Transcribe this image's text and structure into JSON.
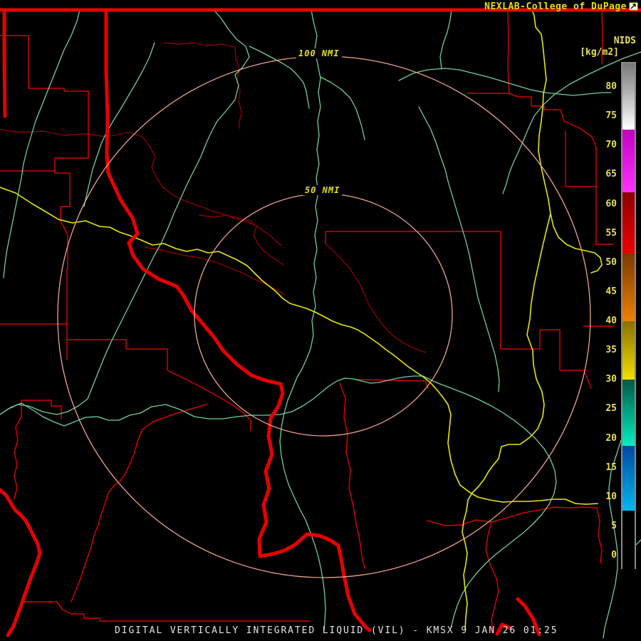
{
  "header": {
    "title": "NEXLAB-College of DuPage",
    "logo_icon": "nw-arrow-box-icon"
  },
  "colorbar": {
    "title": "NIDS",
    "units": "[kg/m2]",
    "ticks": [
      80,
      75,
      70,
      65,
      60,
      55,
      50,
      45,
      40,
      35,
      30,
      25,
      20,
      15,
      10,
      5,
      0
    ],
    "segments": [
      {
        "hi": 84.3,
        "lo": 73.0,
        "top_color": "#787878",
        "bottom_color": "#ffffff"
      },
      {
        "hi": 73.0,
        "lo": 62.3,
        "top_color": "#c400c4",
        "bottom_color": "#ff30ff"
      },
      {
        "hi": 62.3,
        "lo": 51.8,
        "top_color": "#8b0000",
        "bottom_color": "#f00000"
      },
      {
        "hi": 51.8,
        "lo": 40.3,
        "top_color": "#7a3a00",
        "bottom_color": "#f08000"
      },
      {
        "hi": 40.3,
        "lo": 30.3,
        "top_color": "#8a7000",
        "bottom_color": "#f0e000"
      },
      {
        "hi": 30.3,
        "lo": 19.0,
        "top_color": "#005848",
        "bottom_color": "#00f0c0"
      },
      {
        "hi": 19.0,
        "lo": 7.9,
        "top_color": "#0048a0",
        "bottom_color": "#00b8f0"
      },
      {
        "hi": 7.9,
        "lo": -2.2,
        "top_color": "#000000",
        "bottom_color": "#000000"
      }
    ]
  },
  "rings": {
    "outer_label": "100 NMI",
    "inner_label": "50 NMI"
  },
  "footer": {
    "title": "DIGITAL VERTICALLY INTEGRATED LIQUID (VIL) - KMSX 9 JAN 26 01:25",
    "product": "DIGITAL VERTICALLY INTEGRATED LIQUID (VIL)",
    "station": "KMSX",
    "datetime": "9 JAN 26 01:25"
  },
  "map_colors": {
    "background": "#000000",
    "interstate_red": "#e80000",
    "county_red": "#d40000",
    "county_dark_red": "#8b0000",
    "river_green": "#6fcf9c",
    "highway_yellow": "#e8e800",
    "range_ring_salmon": "#f2a48e",
    "label_yellow": "#e8e000",
    "title_white": "#e4e4e4"
  }
}
